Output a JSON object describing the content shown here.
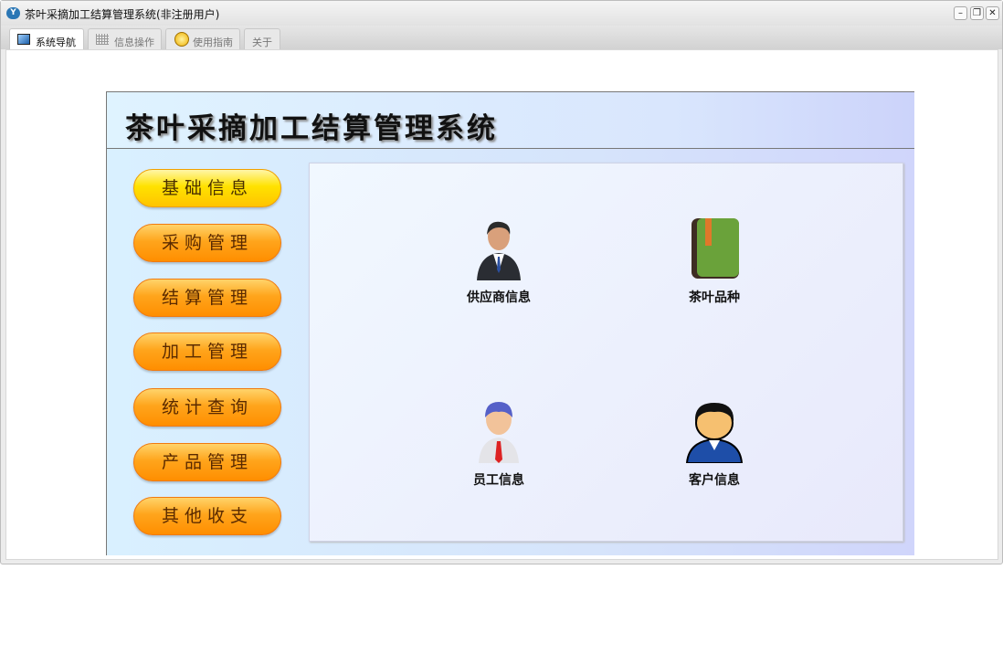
{
  "window": {
    "title": "茶叶采摘加工结算管理系统(非注册用户)"
  },
  "tabs": [
    {
      "label": "系统导航",
      "icon": "monitor-icon"
    },
    {
      "label": "信息操作",
      "icon": "grid-icon"
    },
    {
      "label": "使用指南",
      "icon": "help-icon"
    },
    {
      "label": "关于"
    }
  ],
  "banner": {
    "title": "茶叶采摘加工结算管理系统"
  },
  "menu": [
    "基础信息",
    "采购管理",
    "结算管理",
    "加工管理",
    "统计查询",
    "产品管理",
    "其他收支"
  ],
  "items": [
    {
      "label": "供应商信息",
      "icon": "supplier-icon"
    },
    {
      "label": "茶叶品种",
      "icon": "tea-book-icon"
    },
    {
      "label": "员工信息",
      "icon": "employee-icon"
    },
    {
      "label": "客户信息",
      "icon": "customer-icon"
    }
  ]
}
